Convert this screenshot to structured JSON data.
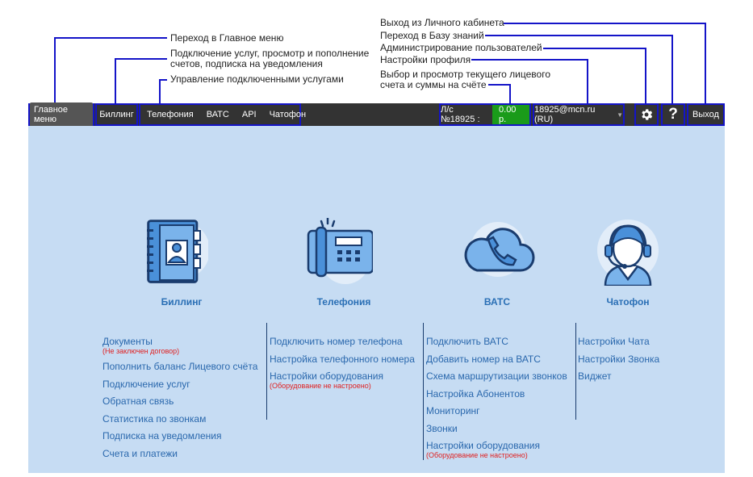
{
  "annotations": {
    "main_menu": "Переход в Главное меню",
    "billing_line1": "Подключение услуг, просмотр и пополнение",
    "billing_line2": "счетов, подписка на уведомления",
    "services": "Управление подключенными услугами",
    "logout": "Выход из Личного кабинета",
    "knowledge": "Переход в Базу знаний",
    "users_admin": "Администрирование пользователей",
    "profile": "Настройки профиля",
    "account_line1": "Выбор и просмотр текущего лицевого",
    "account_line2": "счета и суммы на счёте"
  },
  "topbar": {
    "main_menu": "Главное меню",
    "billing": "Биллинг",
    "tabs": [
      "Телефония",
      "ВАТС",
      "API",
      "Чатофон"
    ],
    "account_label": "Л/с №18925 :",
    "balance": "0.00 р.",
    "user": "18925@mcn.ru (RU)",
    "settings_icon": "gear-icon",
    "help_label": "?",
    "logout": "Выход"
  },
  "colors": {
    "topbar": "#333333",
    "highlight": "#1414c8",
    "panel": "#c6dcf3",
    "link": "#2a68ad",
    "warning": "#e02020",
    "balance": "#1a9b1a"
  },
  "sections": [
    {
      "title": "Биллинг",
      "icon": "address-book-icon",
      "links": [
        {
          "label": "Документы",
          "note": "(Не заключен договор)"
        },
        {
          "label": "Пополнить баланс Лицевого счёта"
        },
        {
          "label": "Подключение услуг"
        },
        {
          "label": "Обратная связь"
        },
        {
          "label": "Статистика по звонкам"
        },
        {
          "label": "Подписка на уведомления"
        },
        {
          "label": "Счета и платежи"
        }
      ]
    },
    {
      "title": "Телефония",
      "icon": "desk-phone-icon",
      "links": [
        {
          "label": "Подключить номер телефона"
        },
        {
          "label": "Настройка телефонного номера"
        },
        {
          "label": "Настройки оборудования",
          "note": "(Оборудование не настроено)"
        }
      ]
    },
    {
      "title": "ВАТС",
      "icon": "cloud-phone-icon",
      "links": [
        {
          "label": "Подключить ВАТС"
        },
        {
          "label": "Добавить номер на ВАТС"
        },
        {
          "label": "Схема маршрутизации звонков"
        },
        {
          "label": "Настройка Абонентов"
        },
        {
          "label": "Мониторинг"
        },
        {
          "label": "Звонки"
        },
        {
          "label": "Настройки оборудования",
          "note": "(Оборудование не настроено)"
        }
      ]
    },
    {
      "title": "Чатофон",
      "icon": "headset-operator-icon",
      "links": [
        {
          "label": "Настройки Чата"
        },
        {
          "label": "Настройки Звонка"
        },
        {
          "label": "Виджет"
        }
      ]
    }
  ]
}
